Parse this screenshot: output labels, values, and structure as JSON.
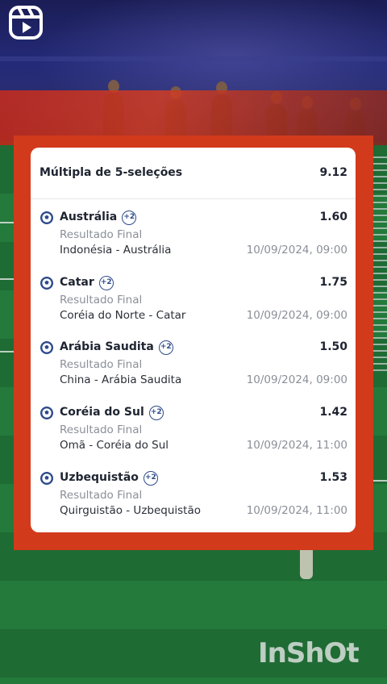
{
  "bet": {
    "title": "Múltipla de 5-seleções",
    "total_odds": "9.12",
    "selections": [
      {
        "team": "Austrália",
        "badge": "+2",
        "odds": "1.60",
        "market": "Resultado Final",
        "match": "Indonésia - Austrália",
        "datetime": "10/09/2024, 09:00"
      },
      {
        "team": "Catar",
        "badge": "+2",
        "odds": "1.75",
        "market": "Resultado Final",
        "match": "Coréia do Norte - Catar",
        "datetime": "10/09/2024, 09:00"
      },
      {
        "team": "Arábia Saudita",
        "badge": "+2",
        "odds": "1.50",
        "market": "Resultado Final",
        "match": "China - Arábia Saudita",
        "datetime": "10/09/2024, 09:00"
      },
      {
        "team": "Coréia do Sul",
        "badge": "+2",
        "odds": "1.42",
        "market": "Resultado Final",
        "match": "Omã - Coréia do Sul",
        "datetime": "10/09/2024, 11:00"
      },
      {
        "team": "Uzbequistão",
        "badge": "+2",
        "odds": "1.53",
        "market": "Resultado Final",
        "match": "Quirguistão - Uzbequistão",
        "datetime": "10/09/2024, 11:00"
      }
    ]
  },
  "watermark": "InShOt",
  "icons": {
    "reels": "reels-icon",
    "sport": "soccer-ball-icon"
  },
  "colors": {
    "frame": "#d23a1c",
    "card": "#ffffff",
    "text": "#1e2430",
    "muted": "#8a8f98",
    "badge": "#2d4a8a"
  }
}
